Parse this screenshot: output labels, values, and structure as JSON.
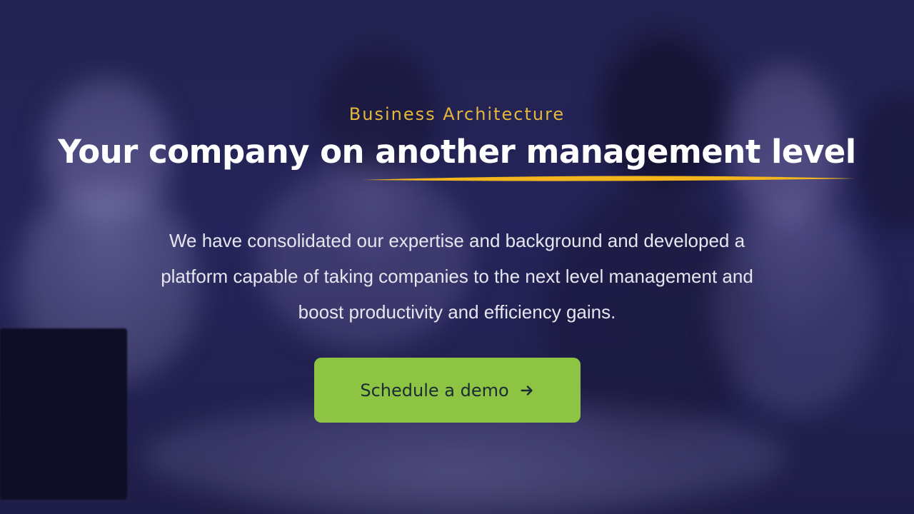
{
  "hero": {
    "eyebrow": "Business Architecture",
    "headline": "Your company on another management level",
    "description": "We have consolidated our expertise and background and developed a platform capable of taking companies to the next level management and boost productivity and efficiency gains.",
    "cta": {
      "label": "Schedule a demo",
      "icon": "arrow-right-icon"
    }
  },
  "colors": {
    "overlay": "#1e1d45",
    "eyebrow": "#e5b73b",
    "underline": "#f2b51e",
    "cta_background": "#8dc443",
    "cta_text": "#1c2a33",
    "headline": "#ffffff"
  }
}
